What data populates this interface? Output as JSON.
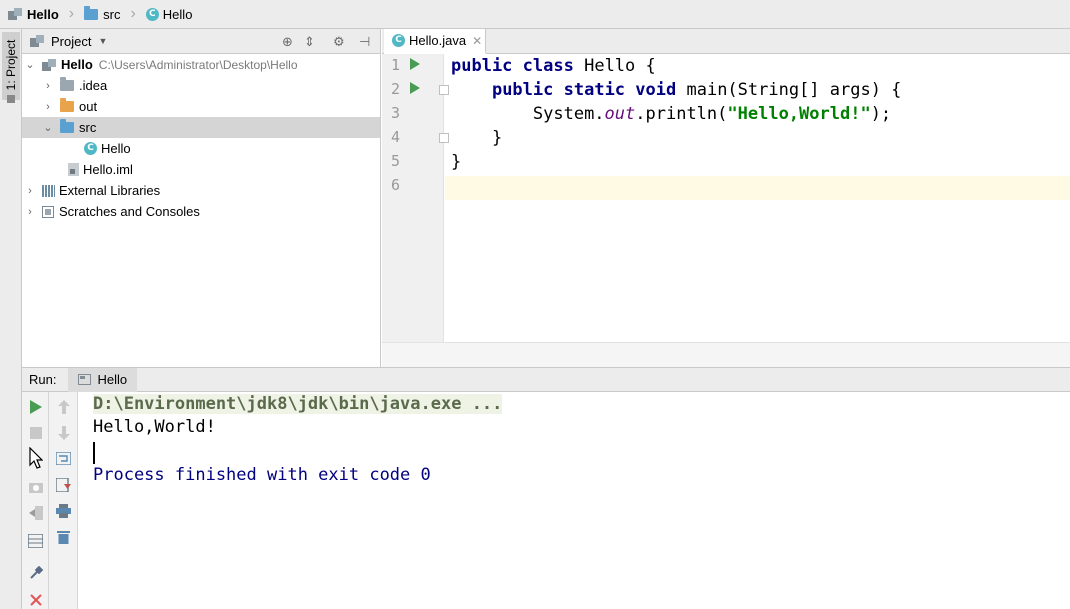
{
  "breadcrumb": {
    "items": [
      {
        "label": "Hello",
        "icon": "project-icon"
      },
      {
        "label": "src",
        "icon": "folder-icon"
      },
      {
        "label": "Hello",
        "icon": "java-class-icon"
      }
    ]
  },
  "left_stripe": {
    "tab_label": "1: Project"
  },
  "project_panel": {
    "title": "Project",
    "tree": [
      {
        "label": "Hello",
        "path": "C:\\Users\\Administrator\\Desktop\\Hello",
        "expanded": true
      },
      {
        "label": ".idea",
        "expanded": false
      },
      {
        "label": "out",
        "expanded": false
      },
      {
        "label": "src",
        "expanded": true,
        "selected": true
      },
      {
        "label": "Hello"
      },
      {
        "label": "Hello.iml"
      },
      {
        "label": "External Libraries",
        "expanded": false
      },
      {
        "label": "Scratches and Consoles",
        "expanded": false
      }
    ]
  },
  "editor": {
    "tab_label": "Hello.java",
    "line_numbers": [
      "1",
      "2",
      "3",
      "4",
      "5",
      "6"
    ],
    "code": {
      "l1_kw1": "public",
      "l1_kw2": "class",
      "l1_rest": " Hello {",
      "l2_kw1": "public",
      "l2_kw2": "static",
      "l2_kw3": "void",
      "l2_rest": " main(String[] args) {",
      "l3_pre": "System.",
      "l3_field": "out",
      "l3_call": ".println(",
      "l3_str": "\"Hello,World!\"",
      "l3_end": ");",
      "l4": "}",
      "l5": "}"
    }
  },
  "run_panel": {
    "label": "Run:",
    "tab_label": "Hello",
    "console": {
      "command": "D:\\Environment\\jdk8\\jdk\\bin\\java.exe ...",
      "output": "Hello,World!",
      "finished": "Process finished with exit code 0"
    }
  },
  "colors": {
    "keyword": "#000080",
    "string": "#008000",
    "field": "#660e7a",
    "run_green": "#499c54",
    "stop_red": "#e05555"
  }
}
